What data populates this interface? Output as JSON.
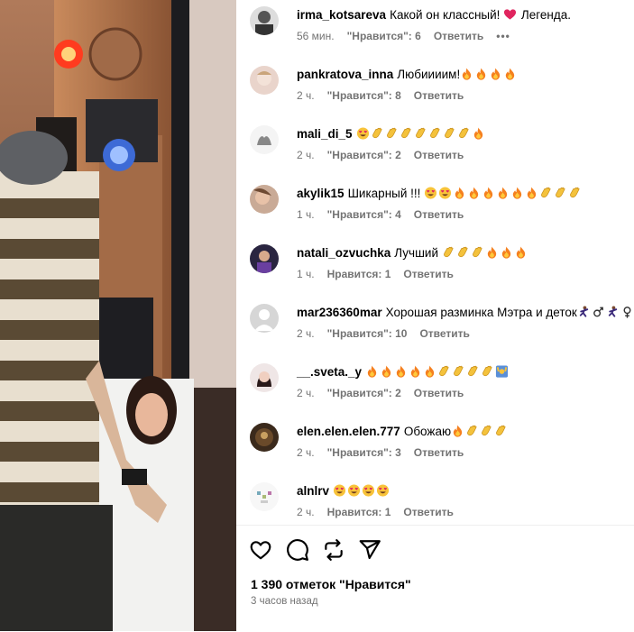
{
  "comments": [
    {
      "username": "irma_kotsareva",
      "text": "Какой он классный! ",
      "emoji": [
        "heart"
      ],
      "after_text": " Легенда.",
      "time": "56 мин.",
      "likes": "\"Нравится\": 6",
      "reply": "Ответить",
      "more": "•••"
    },
    {
      "username": "pankratova_inna",
      "text": "Любиииим!",
      "emoji": [
        "fire",
        "fire",
        "fire",
        "fire"
      ],
      "time": "2 ч.",
      "likes": "\"Нравится\": 8",
      "reply": "Ответить"
    },
    {
      "username": "mali_di_5",
      "text": "",
      "emoji": [
        "hearteyes",
        "clap",
        "clap",
        "clap",
        "clap",
        "clap",
        "clap",
        "clap",
        "fire"
      ],
      "time": "2 ч.",
      "likes": "\"Нравится\": 2",
      "reply": "Ответить"
    },
    {
      "username": "akylik15",
      "text": "Шикарный !!! ",
      "emoji": [
        "hearteyes",
        "hearteyes",
        "fire",
        "fire",
        "fire",
        "fire",
        "fire",
        "fire",
        "clap",
        "clap",
        "clap"
      ],
      "time": "1 ч.",
      "likes": "\"Нравится\": 4",
      "reply": "Ответить"
    },
    {
      "username": "natali_ozvuchka",
      "text": "Лучший ",
      "emoji": [
        "clap",
        "clap",
        "clap",
        "fire",
        "fire",
        "fire"
      ],
      "time": "1 ч.",
      "likes": "Нравится: 1",
      "reply": "Ответить"
    },
    {
      "username": "mar236360mar",
      "text": "Хорошая разминка Мэтра и деток",
      "emoji": [
        "dancer",
        "male",
        "dancer",
        "female"
      ],
      "time": "2 ч.",
      "likes": "\"Нравится\": 10",
      "reply": "Ответить"
    },
    {
      "username": "__.sveta._y",
      "text": "",
      "emoji": [
        "fire",
        "fire",
        "fire",
        "fire",
        "fire",
        "clap",
        "clap",
        "clap",
        "clap",
        "raise"
      ],
      "time": "2 ч.",
      "likes": "\"Нравится\": 2",
      "reply": "Ответить"
    },
    {
      "username": "elen.elen.elen.777",
      "text": "Обожаю",
      "emoji": [
        "fire",
        "clap",
        "clap",
        "clap"
      ],
      "time": "2 ч.",
      "likes": "\"Нравится\": 3",
      "reply": "Ответить"
    },
    {
      "username": "alnlrv",
      "text": "",
      "emoji": [
        "hearteyes",
        "hearteyes",
        "hearteyes",
        "hearteyes"
      ],
      "time": "2 ч.",
      "likes": "Нравится: 1",
      "reply": "Ответить"
    }
  ],
  "actions": {
    "icons": [
      "heart-outline-icon",
      "comment-icon",
      "repost-icon",
      "share-icon"
    ],
    "like_count": "1 390 отметок \"Нравится\"",
    "time": "3 часов назад"
  },
  "colors": {
    "fire": "#f5801f",
    "clap": "#f4c23c",
    "heart": "#e0245e",
    "muted": "#737373"
  }
}
